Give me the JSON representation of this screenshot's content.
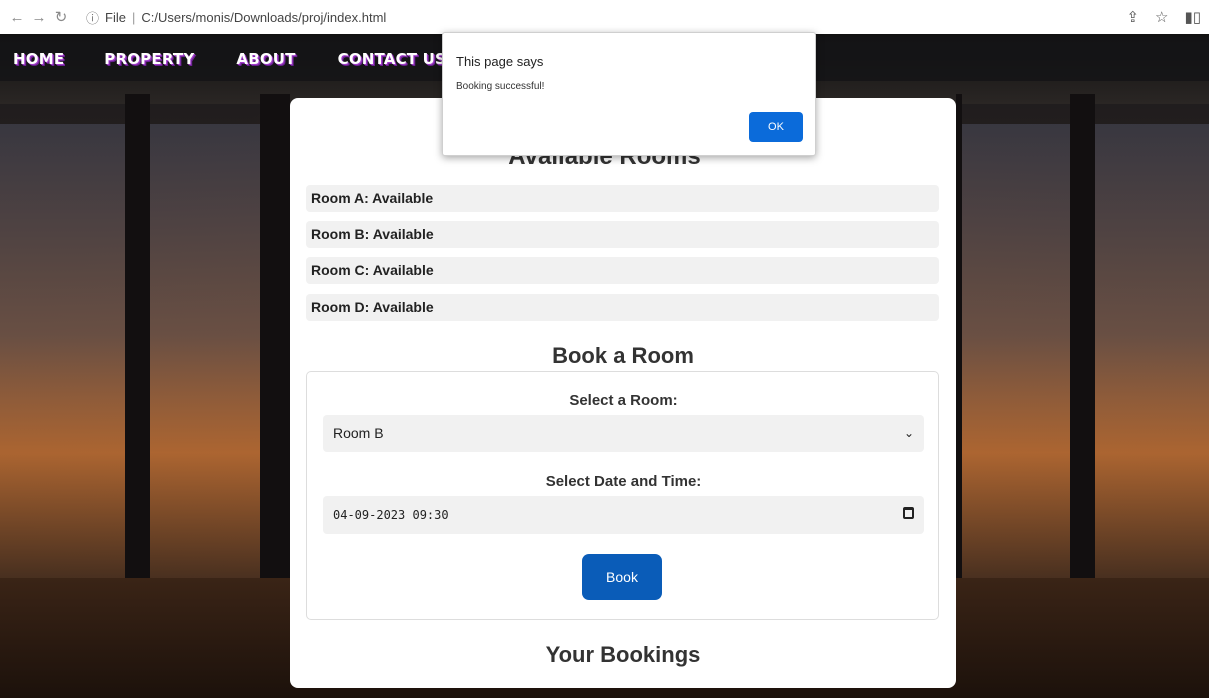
{
  "browser": {
    "back_icon": "arrow-left",
    "forward_icon": "arrow-right",
    "reload_icon": "reload",
    "info_icon": "info-circle",
    "scheme_label": "File",
    "path": "C:/Users/monis/Downloads/proj/index.html"
  },
  "nav": {
    "home": "HOME",
    "property": "PROPERTY",
    "about": "ABOUT",
    "contact": "CONTACT US"
  },
  "rooms": {
    "title": "Available Rooms",
    "items": [
      "Room A: Available",
      "Room B: Available",
      "Room C: Available",
      "Room D: Available"
    ]
  },
  "booking": {
    "title": "Book a Room",
    "room_label": "Select a Room:",
    "room_selected": "Room B",
    "date_label": "Select Date and Time:",
    "date_value": "04-09-2023 09:30",
    "book_label": "Book"
  },
  "bookings": {
    "title": "Your Bookings"
  },
  "dialog": {
    "title": "This page says",
    "message": "Booking successful!",
    "ok_label": "OK"
  },
  "colors": {
    "primary_button": "#0a5cb8",
    "dialog_ok": "#0b6bda",
    "nav_text_shadow": "#a13cc9"
  }
}
